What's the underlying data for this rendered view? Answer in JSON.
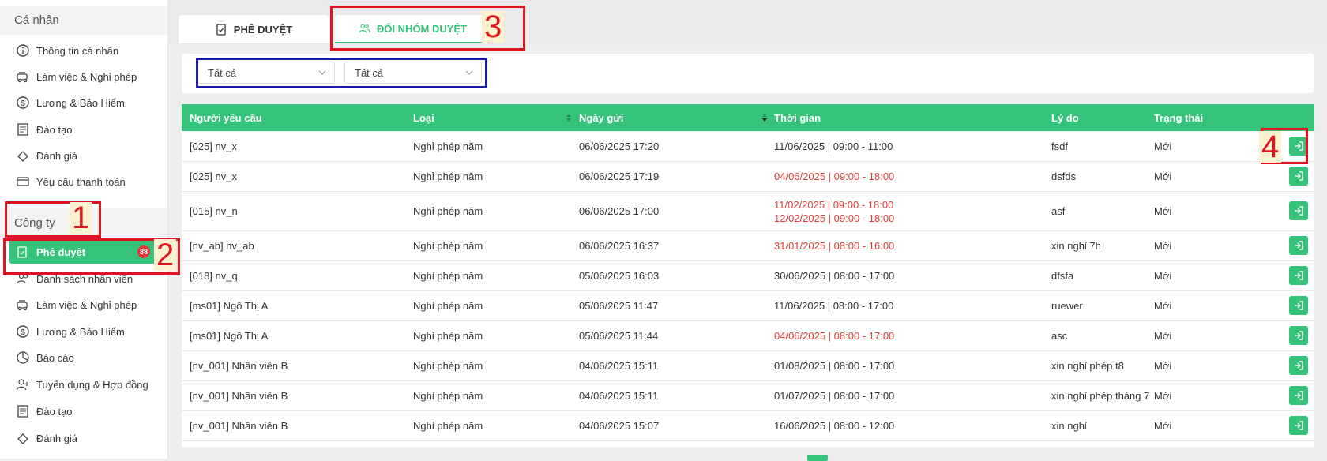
{
  "sidebar": {
    "personal_title": "Cá nhân",
    "personal_items": [
      {
        "label": "Thông tin cá nhân",
        "icon": "info-icon"
      },
      {
        "label": "Làm việc & Nghỉ phép",
        "icon": "car-icon"
      },
      {
        "label": "Lương & Bảo Hiểm",
        "icon": "dollar-icon"
      },
      {
        "label": "Đào tạo",
        "icon": "training-icon"
      },
      {
        "label": "Đánh giá",
        "icon": "review-icon"
      },
      {
        "label": "Yêu cầu thanh toán",
        "icon": "payment-card-icon"
      }
    ],
    "company_title": "Công ty",
    "active_item": {
      "label": "Phê duyệt",
      "badge": "88",
      "icon": "clipboard-check-icon"
    },
    "company_items": [
      {
        "label": "Danh sách nhân viên",
        "icon": "users-icon"
      },
      {
        "label": "Làm việc & Nghỉ phép",
        "icon": "car-icon"
      },
      {
        "label": "Lương & Bảo Hiểm",
        "icon": "dollar-icon"
      },
      {
        "label": "Báo cáo",
        "icon": "pie-chart-icon"
      },
      {
        "label": "Tuyển dụng & Hợp đồng",
        "icon": "user-add-icon"
      },
      {
        "label": "Đào tạo",
        "icon": "training-icon"
      },
      {
        "label": "Đánh giá",
        "icon": "review-icon"
      }
    ]
  },
  "tabs": [
    {
      "label": "PHÊ DUYỆT",
      "active": false
    },
    {
      "label": "ĐỔI NHÓM DUYỆT",
      "active": true
    }
  ],
  "filters": [
    {
      "value": "Tất cả"
    },
    {
      "value": "Tất cả"
    }
  ],
  "table": {
    "headers": [
      "Người yêu cầu",
      "Loại",
      "Ngày gửi",
      "Thời gian",
      "Lý do",
      "Trạng thái"
    ],
    "rows": [
      {
        "requester": "[025] nv_x",
        "type": "Nghỉ phép năm",
        "sent": "06/06/2025 17:20",
        "time": [
          "11/06/2025 | 09:00 - 11:00"
        ],
        "time_red": false,
        "reason": "fsdf",
        "status": "Mới"
      },
      {
        "requester": "[025] nv_x",
        "type": "Nghỉ phép năm",
        "sent": "06/06/2025 17:19",
        "time": [
          "04/06/2025 | 09:00 - 18:00"
        ],
        "time_red": true,
        "reason": "dsfds",
        "status": "Mới"
      },
      {
        "requester": "[015] nv_n",
        "type": "Nghỉ phép năm",
        "sent": "06/06/2025 17:00",
        "time": [
          "11/02/2025 | 09:00 - 18:00",
          "12/02/2025 | 09:00 - 18:00"
        ],
        "time_red": true,
        "reason": "asf",
        "status": "Mới"
      },
      {
        "requester": "[nv_ab] nv_ab",
        "type": "Nghỉ phép năm",
        "sent": "06/06/2025 16:37",
        "time": [
          "31/01/2025 | 08:00 - 16:00"
        ],
        "time_red": true,
        "reason": "xin nghỉ 7h",
        "status": "Mới"
      },
      {
        "requester": "[018] nv_q",
        "type": "Nghỉ phép năm",
        "sent": "05/06/2025 16:03",
        "time": [
          "30/06/2025 | 08:00 - 17:00"
        ],
        "time_red": false,
        "reason": "dfsfa",
        "status": "Mới"
      },
      {
        "requester": "[ms01] Ngô Thị A",
        "type": "Nghỉ phép năm",
        "sent": "05/06/2025 11:47",
        "time": [
          "11/06/2025 | 08:00 - 17:00"
        ],
        "time_red": false,
        "reason": "ruewer",
        "status": "Mới"
      },
      {
        "requester": "[ms01] Ngô Thị A",
        "type": "Nghỉ phép năm",
        "sent": "05/06/2025 11:44",
        "time": [
          "04/06/2025 | 08:00 - 17:00"
        ],
        "time_red": true,
        "reason": "asc",
        "status": "Mới"
      },
      {
        "requester": "[nv_001] Nhân viên B",
        "type": "Nghỉ phép năm",
        "sent": "04/06/2025 15:11",
        "time": [
          "01/08/2025 | 08:00 - 17:00"
        ],
        "time_red": false,
        "reason": "xin nghỉ phép t8",
        "status": "Mới"
      },
      {
        "requester": "[nv_001] Nhân viên B",
        "type": "Nghỉ phép năm",
        "sent": "04/06/2025 15:11",
        "time": [
          "01/07/2025 | 08:00 - 17:00"
        ],
        "time_red": false,
        "reason": "xin nghỉ phép tháng 7",
        "status": "Mới"
      },
      {
        "requester": "[nv_001] Nhân viên B",
        "type": "Nghỉ phép năm",
        "sent": "04/06/2025 15:07",
        "time": [
          "16/06/2025 | 08:00 - 12:00"
        ],
        "time_red": false,
        "reason": "xin nghỉ",
        "status": "Mới"
      }
    ]
  },
  "annotations": [
    "1",
    "2",
    "3",
    "4"
  ],
  "colors": {
    "accent": "#35c27a",
    "danger": "#e23a3a",
    "annotation": "#e0141e",
    "filter_outline": "#1a1aa8"
  }
}
